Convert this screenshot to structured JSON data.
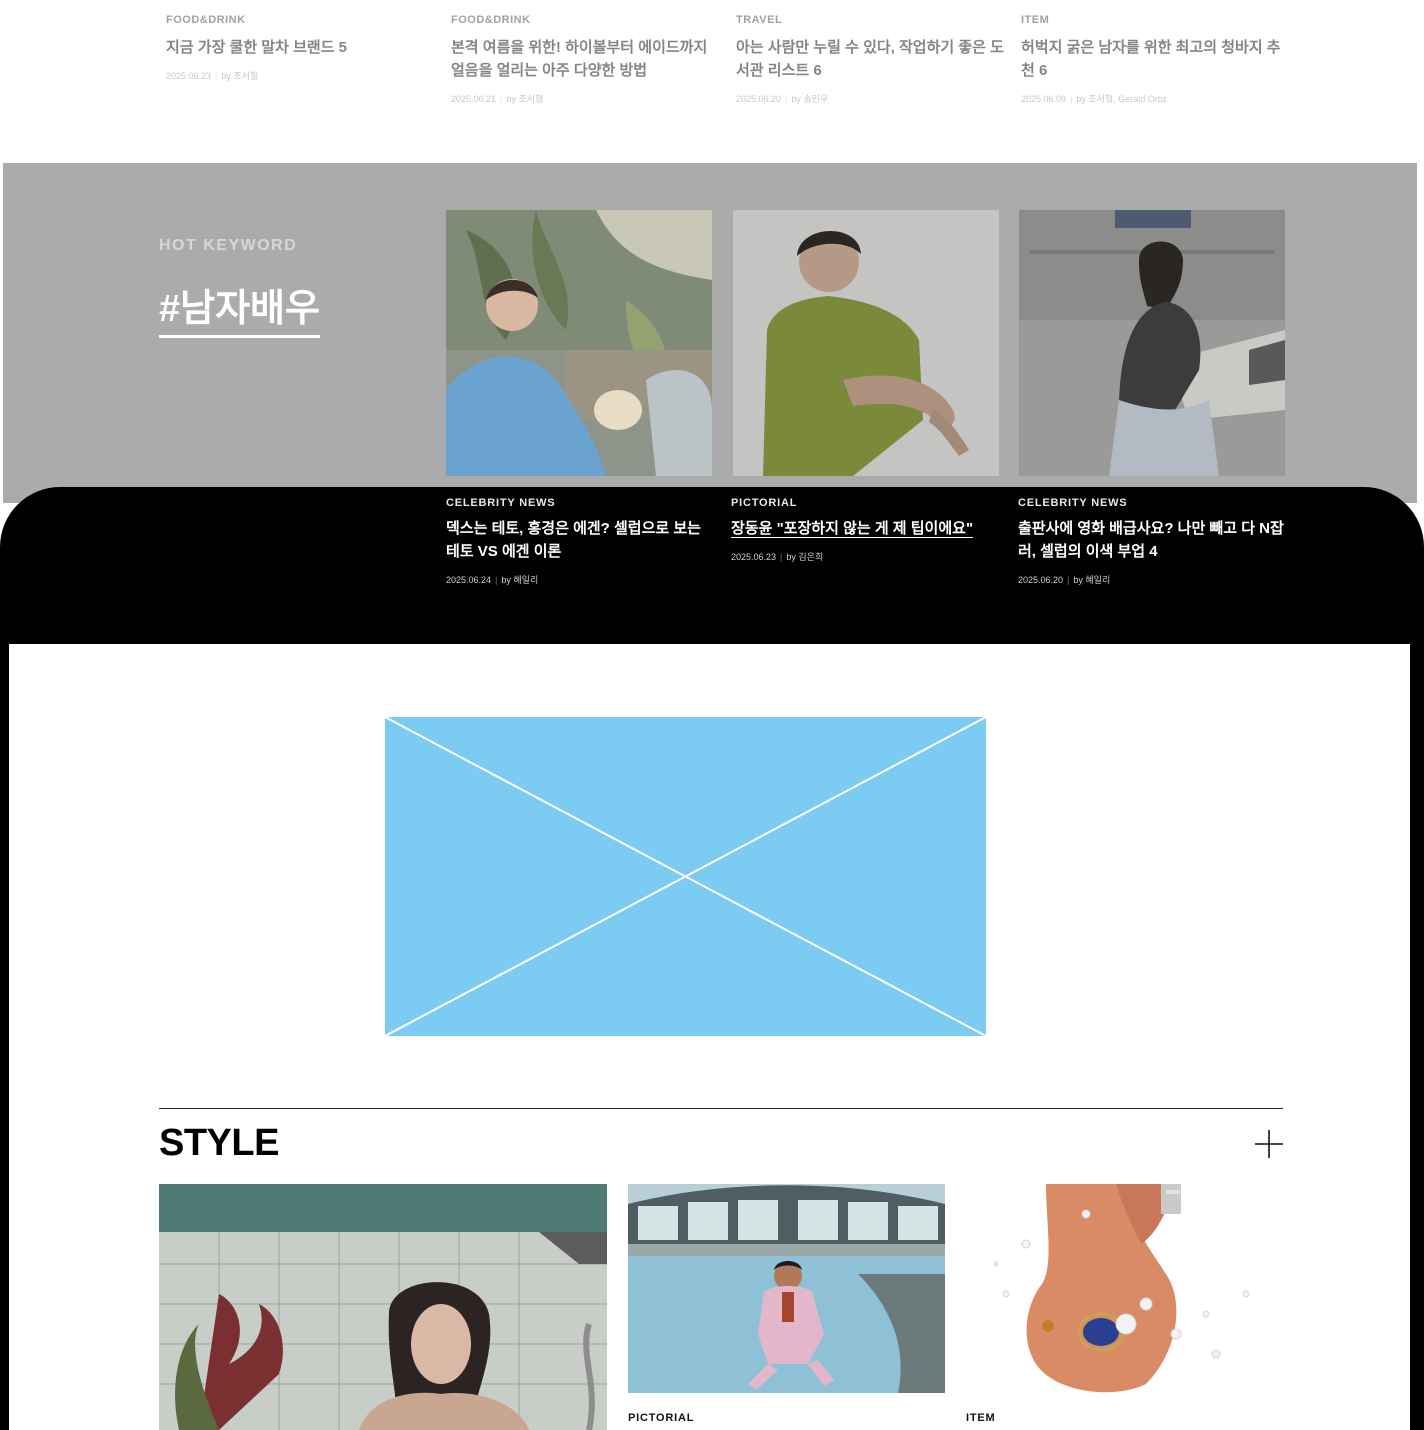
{
  "top_articles": [
    {
      "category": "FOOD&DRINK",
      "title": "지금 가장 쿨한 말차 브랜드 5",
      "date": "2025.06.23",
      "author": "by 조서형"
    },
    {
      "category": "FOOD&DRINK",
      "title": "본격 여름을 위한! 하이볼부터 에이드까지 얼음을 얼리는 아주 다양한 방법",
      "date": "2025.06.21",
      "author": "by 조서형"
    },
    {
      "category": "TRAVEL",
      "title": "아는 사람만 누릴 수 있다, 작업하기 좋은 도서관 리스트 6",
      "date": "2025.06.20",
      "author": "by 송민우"
    },
    {
      "category": "ITEM",
      "title": "허벅지 굵은 남자를 위한 최고의 청바지 추천 6",
      "date": "2025.06.09",
      "author": "by 조서형, Gerald Ortiz"
    }
  ],
  "hot_keyword": {
    "label": "HOT KEYWORD",
    "keyword": "#남자배우",
    "articles": [
      {
        "category": "CELEBRITY NEWS",
        "title": "덱스는 테토, 홍경은 에겐? 셀럽으로 보는 테토 VS 에겐 이론",
        "date": "2025.06.24",
        "author": "by 혜일리"
      },
      {
        "category": "PICTORIAL",
        "title": "장동윤 \"포장하지 않는 게 제 팁이에요\"",
        "date": "2025.06.23",
        "author": "by 김은희"
      },
      {
        "category": "CELEBRITY NEWS",
        "title": "출판사에 영화 배급사요? 나만 빼고 다 N잡러, 셀럽의 이색 부업 4",
        "date": "2025.06.20",
        "author": "by 혜일리"
      }
    ]
  },
  "style_section": {
    "title": "STYLE",
    "items": [
      {
        "category": ""
      },
      {
        "category": "PICTORIAL"
      },
      {
        "category": "ITEM"
      }
    ]
  },
  "colors": {
    "overlay": "#000000",
    "dim": "#ababab",
    "placeholder": "#7ccbf3"
  }
}
